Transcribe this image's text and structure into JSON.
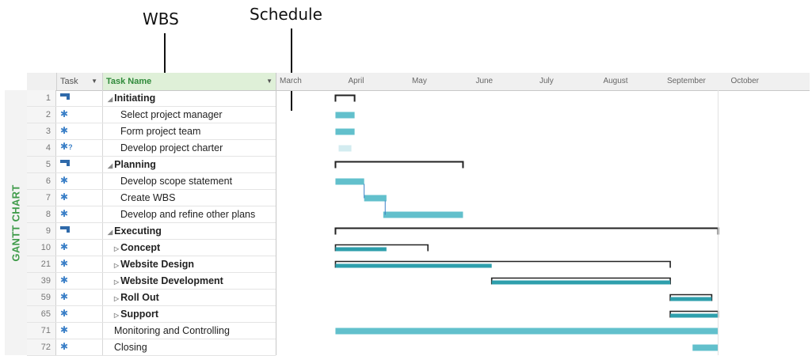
{
  "callouts": {
    "wbs": "WBS",
    "schedule": "Schedule"
  },
  "side_tab": "GANTT CHART",
  "grid_headers": {
    "mode": "Task",
    "name": "Task Name"
  },
  "months": [
    "March",
    "April",
    "May",
    "June",
    "July",
    "August",
    "September",
    "October"
  ],
  "tasks": [
    {
      "num": "1",
      "name": "Initiating",
      "bold": true,
      "collapse": "open",
      "indent": 0,
      "icon": "summary-task-icon"
    },
    {
      "num": "2",
      "name": "Select project manager",
      "bold": false,
      "collapse": "",
      "indent": 2,
      "icon": "pin-icon"
    },
    {
      "num": "3",
      "name": "Form project team",
      "bold": false,
      "collapse": "",
      "indent": 2,
      "icon": "pin-icon"
    },
    {
      "num": "4",
      "name": "Develop project charter",
      "bold": false,
      "collapse": "",
      "indent": 2,
      "icon": "pin-question-icon"
    },
    {
      "num": "5",
      "name": "Planning",
      "bold": true,
      "collapse": "open",
      "indent": 0,
      "icon": "summary-task-icon"
    },
    {
      "num": "6",
      "name": "Develop scope statement",
      "bold": false,
      "collapse": "",
      "indent": 2,
      "icon": "pin-icon"
    },
    {
      "num": "7",
      "name": "Create WBS",
      "bold": false,
      "collapse": "",
      "indent": 2,
      "icon": "pin-icon"
    },
    {
      "num": "8",
      "name": "Develop and refine other plans",
      "bold": false,
      "collapse": "",
      "indent": 2,
      "icon": "pin-icon"
    },
    {
      "num": "9",
      "name": "Executing",
      "bold": true,
      "collapse": "open",
      "indent": 0,
      "icon": "summary-task-icon"
    },
    {
      "num": "10",
      "name": "Concept",
      "bold": true,
      "collapse": "closed",
      "indent": 1,
      "icon": "pin-icon"
    },
    {
      "num": "21",
      "name": "Website Design",
      "bold": true,
      "collapse": "closed",
      "indent": 1,
      "icon": "pin-icon"
    },
    {
      "num": "39",
      "name": "Website Development",
      "bold": true,
      "collapse": "closed",
      "indent": 1,
      "icon": "pin-icon"
    },
    {
      "num": "59",
      "name": "Roll Out",
      "bold": true,
      "collapse": "closed",
      "indent": 1,
      "icon": "pin-icon"
    },
    {
      "num": "65",
      "name": "Support",
      "bold": true,
      "collapse": "closed",
      "indent": 1,
      "icon": "pin-icon"
    },
    {
      "num": "71",
      "name": "Monitoring and Controlling",
      "bold": false,
      "collapse": "",
      "indent": 1,
      "icon": "pin-icon"
    },
    {
      "num": "72",
      "name": "Closing",
      "bold": false,
      "collapse": "",
      "indent": 1,
      "icon": "pin-icon"
    }
  ],
  "gantt": {
    "colors": {
      "task_bar": "#62c0cc",
      "task_bar_dark": "#2e9fac",
      "summary_line": "#222222",
      "placeholder": "#d3ecf0"
    },
    "bars": [
      {
        "row": 0,
        "kind": "summary",
        "start_month": 1.0,
        "end_month": 1.3
      },
      {
        "row": 1,
        "kind": "task",
        "start_month": 1.0,
        "end_month": 1.3
      },
      {
        "row": 2,
        "kind": "task",
        "start_month": 1.0,
        "end_month": 1.3
      },
      {
        "row": 3,
        "kind": "placeholder",
        "start_month": 1.05,
        "end_month": 1.25
      },
      {
        "row": 4,
        "kind": "summary",
        "start_month": 1.0,
        "end_month": 3.0
      },
      {
        "row": 5,
        "kind": "task",
        "start_month": 1.0,
        "end_month": 1.45
      },
      {
        "row": 6,
        "kind": "task",
        "start_month": 1.45,
        "end_month": 1.8
      },
      {
        "row": 7,
        "kind": "task",
        "start_month": 1.75,
        "end_month": 3.0
      },
      {
        "row": 8,
        "kind": "summary",
        "start_month": 1.0,
        "end_month": 7.0
      },
      {
        "row": 9,
        "kind": "rollup",
        "start_month": 1.0,
        "end_month": 2.45,
        "progress_end_month": 1.8
      },
      {
        "row": 10,
        "kind": "rollup",
        "start_month": 1.0,
        "end_month": 6.25,
        "progress_end_month": 3.45
      },
      {
        "row": 11,
        "kind": "rollup",
        "start_month": 3.45,
        "end_month": 6.25,
        "progress_end_month": 6.25
      },
      {
        "row": 12,
        "kind": "rollup",
        "start_month": 6.25,
        "end_month": 6.9,
        "progress_end_month": 6.9
      },
      {
        "row": 13,
        "kind": "rollup",
        "start_month": 6.25,
        "end_month": 7.0,
        "progress_end_month": 7.0
      },
      {
        "row": 14,
        "kind": "task",
        "start_month": 1.0,
        "end_month": 7.0
      },
      {
        "row": 15,
        "kind": "task",
        "start_month": 6.6,
        "end_month": 7.0
      }
    ]
  }
}
